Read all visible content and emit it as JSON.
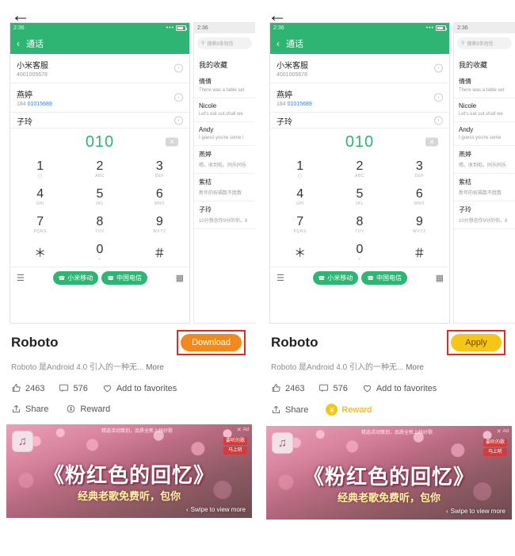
{
  "panels": [
    {
      "id": "left",
      "back_icon": "arrow-left-icon",
      "phone": {
        "status_time": "2:36",
        "status_dots": "•••",
        "appbar_back": "chevron-left-icon",
        "appbar_title": "通话",
        "contacts": [
          {
            "name": "小米客服",
            "number": "4001005678",
            "number_blue": ""
          },
          {
            "name": "燕婷",
            "number_prefix": "184 ",
            "number_blue": "01015689"
          },
          {
            "name": "子玲",
            "number": ""
          }
        ],
        "dial_digits": "010",
        "delete_icon": "backspace-icon",
        "keys": [
          {
            "digit": "1",
            "letters": "〇"
          },
          {
            "digit": "2",
            "letters": "ABC"
          },
          {
            "digit": "3",
            "letters": "DEF"
          },
          {
            "digit": "4",
            "letters": "GHI"
          },
          {
            "digit": "5",
            "letters": "JKL"
          },
          {
            "digit": "6",
            "letters": "MNO"
          },
          {
            "digit": "7",
            "letters": "PQRS"
          },
          {
            "digit": "8",
            "letters": "TUV"
          },
          {
            "digit": "9",
            "letters": "WXYZ"
          },
          {
            "digit": "＊",
            "letters": ""
          },
          {
            "digit": "0",
            "letters": "+"
          },
          {
            "digit": "＃",
            "letters": ""
          }
        ],
        "menu_icon": "menu-icon",
        "keypad_icon": "keypad-icon",
        "sim_buttons": [
          {
            "label": "小米移动",
            "icon": "phone-icon"
          },
          {
            "label": "中国电信",
            "icon": "phone-icon"
          }
        ]
      },
      "sms": {
        "status_time": "2:36",
        "search_placeholder": "搜索8条短信",
        "search_icon": "search-icon",
        "title": "我的收藏",
        "items": [
          {
            "name": "倩倩",
            "preview": "There was a table set"
          },
          {
            "name": "Nicole",
            "preview": "Let's eat out,shall we"
          },
          {
            "name": "Andy",
            "preview": "I guess you're some l"
          },
          {
            "name": "燕婷",
            "preview": "嗯。收到啦。同乐同乐"
          },
          {
            "name": "紫桔",
            "preview": "新年的祝福数不胜数"
          },
          {
            "name": "子玲",
            "preview": "10分想念你9分的你。8"
          }
        ]
      },
      "info": {
        "font_name": "Roboto",
        "description": "Roboto 是Android 4.0 引入的一种无...",
        "more": "More",
        "action_label": "Download",
        "action_type": "download"
      },
      "stats": {
        "like_icon": "thumbs-up-icon",
        "likes": "2463",
        "comment_icon": "comment-icon",
        "comments": "576",
        "favorite_icon": "heart-icon",
        "favorite_label": "Add to favorites",
        "share_icon": "share-icon",
        "share_label": "Share",
        "reward_icon": "coin-icon",
        "reward_label": "Reward",
        "reward_active": false
      },
      "ad": {
        "logo_icon": "music-app-icon",
        "top_text": "精选活动策划，品质全新上线好歌",
        "label": "Ad",
        "close_icon": "close-icon",
        "badge_line1": "要听的歌",
        "badge_line2": "马上听",
        "headline": "《粉红色的回忆》",
        "subline": "经典老歌免费听，包你",
        "swipe_label": "Swipe to view more",
        "swipe_icon": "chevron-left-icon"
      }
    },
    {
      "id": "right",
      "back_icon": "arrow-left-icon",
      "phone": {
        "status_time": "2:36",
        "status_dots": "•••",
        "appbar_back": "chevron-left-icon",
        "appbar_title": "通话",
        "contacts": [
          {
            "name": "小米客服",
            "number": "4001005678",
            "number_blue": ""
          },
          {
            "name": "燕婷",
            "number_prefix": "184 ",
            "number_blue": "01015689"
          },
          {
            "name": "子玲",
            "number": ""
          }
        ],
        "dial_digits": "010",
        "delete_icon": "backspace-icon",
        "keys": [
          {
            "digit": "1",
            "letters": "〇"
          },
          {
            "digit": "2",
            "letters": "ABC"
          },
          {
            "digit": "3",
            "letters": "DEF"
          },
          {
            "digit": "4",
            "letters": "GHI"
          },
          {
            "digit": "5",
            "letters": "JKL"
          },
          {
            "digit": "6",
            "letters": "MNO"
          },
          {
            "digit": "7",
            "letters": "PQRS"
          },
          {
            "digit": "8",
            "letters": "TUV"
          },
          {
            "digit": "9",
            "letters": "WXYZ"
          },
          {
            "digit": "＊",
            "letters": ""
          },
          {
            "digit": "0",
            "letters": "+"
          },
          {
            "digit": "＃",
            "letters": ""
          }
        ],
        "menu_icon": "menu-icon",
        "keypad_icon": "keypad-icon",
        "sim_buttons": [
          {
            "label": "小米移动",
            "icon": "phone-icon"
          },
          {
            "label": "中国电信",
            "icon": "phone-icon"
          }
        ]
      },
      "sms": {
        "status_time": "2:36",
        "search_placeholder": "搜索8条短信",
        "search_icon": "search-icon",
        "title": "我的收藏",
        "items": [
          {
            "name": "倩倩",
            "preview": "There was a table set"
          },
          {
            "name": "Nicole",
            "preview": "Let's eat out,shall we"
          },
          {
            "name": "Andy",
            "preview": "I guess you're some"
          },
          {
            "name": "燕婷",
            "preview": "嗯。收到啦。同乐同乐"
          },
          {
            "name": "紫桔",
            "preview": "新年的祝福数不胜数"
          },
          {
            "name": "子玲",
            "preview": "10分想念你9分的你。8"
          }
        ]
      },
      "info": {
        "font_name": "Roboto",
        "description": "Roboto 是Android 4.0 引入的一种无...",
        "more": "More",
        "action_label": "Apply",
        "action_type": "apply"
      },
      "stats": {
        "like_icon": "thumbs-up-icon",
        "likes": "2463",
        "comment_icon": "comment-icon",
        "comments": "576",
        "favorite_icon": "heart-icon",
        "favorite_label": "Add to favorites",
        "share_icon": "share-icon",
        "share_label": "Share",
        "reward_icon": "coin-icon",
        "reward_label": "Reward",
        "reward_active": true
      },
      "ad": {
        "logo_icon": "music-app-icon",
        "top_text": "精选活动策划，品质全新上线好歌",
        "label": "Ad",
        "close_icon": "close-icon",
        "badge_line1": "要听的歌",
        "badge_line2": "马上听",
        "headline": "《粉红色的回忆》",
        "subline": "经典老歌免费听，包你",
        "swipe_label": "Swipe to view more",
        "swipe_icon": "chevron-left-icon"
      }
    }
  ],
  "colors": {
    "accent_green": "#2fb573",
    "download_orange": "#f08a1e",
    "apply_yellow": "#f5c518",
    "highlight_red": "#e02b20",
    "link_blue": "#2f7fd6"
  }
}
